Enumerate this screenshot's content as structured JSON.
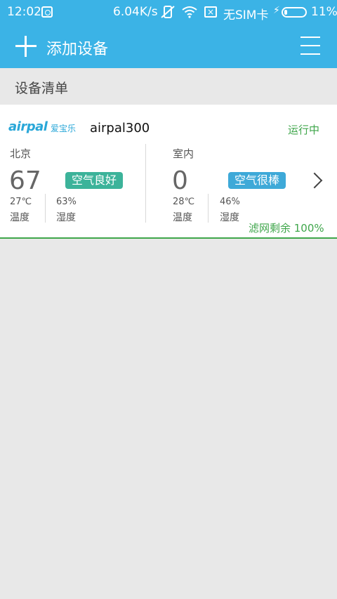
{
  "status_bar": {
    "time": "12:02",
    "net_speed": "6.04K/s",
    "sim_text": "无SIM卡",
    "sim_icon_text": "×",
    "battery_pct": "11%"
  },
  "app_bar": {
    "title": "添加设备"
  },
  "section": {
    "title": "设备清单"
  },
  "device": {
    "brand": "airpal",
    "brand_cn": "爱宝乐",
    "name": "airpal300",
    "status": "运行中",
    "outdoor": {
      "location": "北京",
      "aqi": "67",
      "quality": "空气良好",
      "temperature": "27℃",
      "temperature_label": "温度",
      "humidity": "63%",
      "humidity_label": "湿度"
    },
    "indoor": {
      "location": "室内",
      "aqi": "0",
      "quality": "空气很棒",
      "temperature": "28℃",
      "temperature_label": "温度",
      "humidity": "46%",
      "humidity_label": "湿度"
    },
    "filter_text": "滤网剩余 100%"
  },
  "colors": {
    "primary": "#3bb3e6",
    "good_badge": "#3cb39a",
    "great_badge": "#3ea9d8",
    "running_green": "#3fa64b",
    "background": "#e8e8e8"
  }
}
